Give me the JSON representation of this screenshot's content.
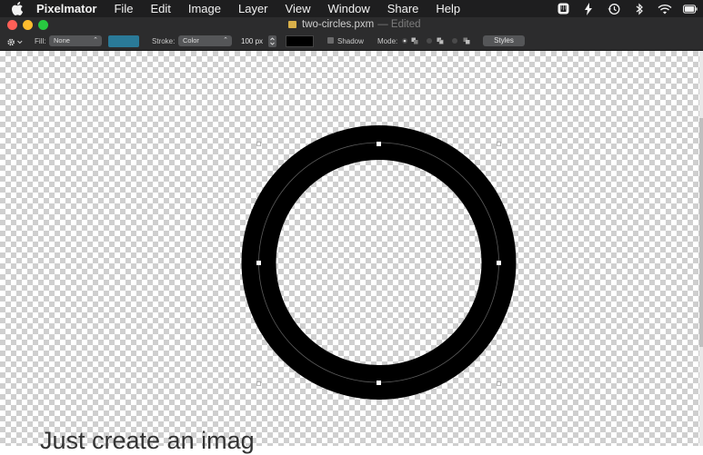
{
  "menubar": {
    "app_name": "Pixelmator",
    "items": [
      "File",
      "Edit",
      "Image",
      "Layer",
      "View",
      "Window",
      "Share",
      "Help"
    ]
  },
  "status_icons": [
    "sync-app-icon",
    "bolt-icon",
    "time-machine-icon",
    "bluetooth-icon",
    "wifi-icon",
    "battery-icon"
  ],
  "window": {
    "document_name": "two-circles.pxm",
    "document_state": "— Edited"
  },
  "toolbar": {
    "fill_label": "Fill:",
    "fill_value": "None",
    "fill_color": "#2a7a98",
    "stroke_label": "Stroke:",
    "stroke_value": "Color",
    "stroke_width": "100 px",
    "stroke_color": "#000000",
    "shadow_label": "Shadow",
    "mode_label": "Mode:",
    "styles_label": "Styles"
  },
  "canvas": {
    "background_text": "Just create an imag"
  }
}
